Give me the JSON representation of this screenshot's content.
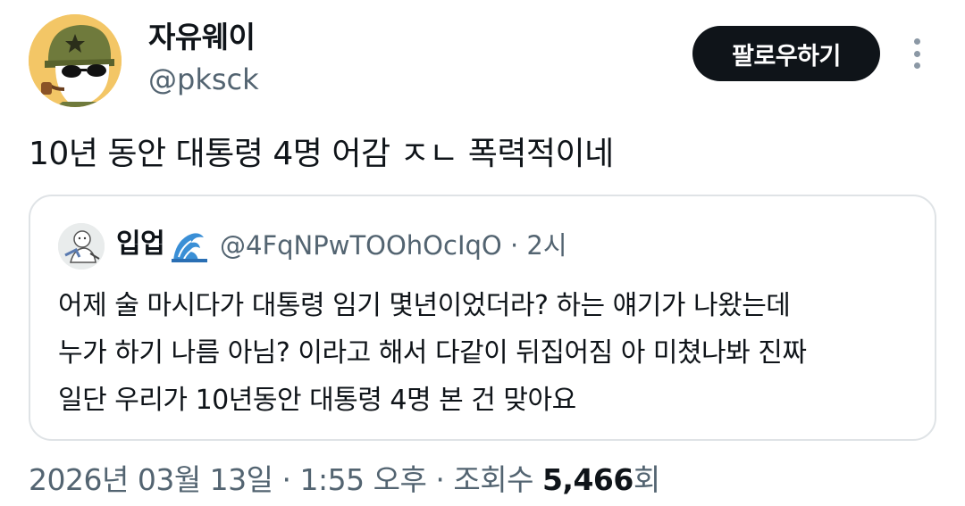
{
  "author": {
    "display_name": "자유웨이",
    "handle": "@pksck",
    "avatar_icon": "cartoon-soldier-avatar"
  },
  "header": {
    "follow_label": "팔로우하기",
    "more_icon": "more-vertical-icon"
  },
  "tweet": {
    "text": "10년 동안 대통령 4명 어감 ㅈㄴ 폭력적이네"
  },
  "quote": {
    "display_name": "입업",
    "name_emoji": "wave-icon",
    "handle": "@4FqNPwTOOhOcIqO",
    "separator": "·",
    "time": "2시",
    "lines": [
      "어제 술 마시다가 대통령 임기 몇년이었더라? 하는 얘기가 나왔는데",
      "누가 하기 나름 아님? 이라고 해서 다같이 뒤집어짐 아 미쳤나봐 진짜",
      "일단 우리가 10년동안 대통령 4명 본 건 맞아요"
    ]
  },
  "footer": {
    "date": "2026년 03월 13일",
    "sep1": "·",
    "time": "1:55 오후",
    "sep2": "·",
    "views_label": "조회수",
    "views_count": "5,466",
    "views_suffix": "회"
  },
  "colors": {
    "text_primary": "#0f1419",
    "text_secondary": "#536471",
    "border": "#dfe3e6",
    "follow_bg": "#0f1419"
  }
}
